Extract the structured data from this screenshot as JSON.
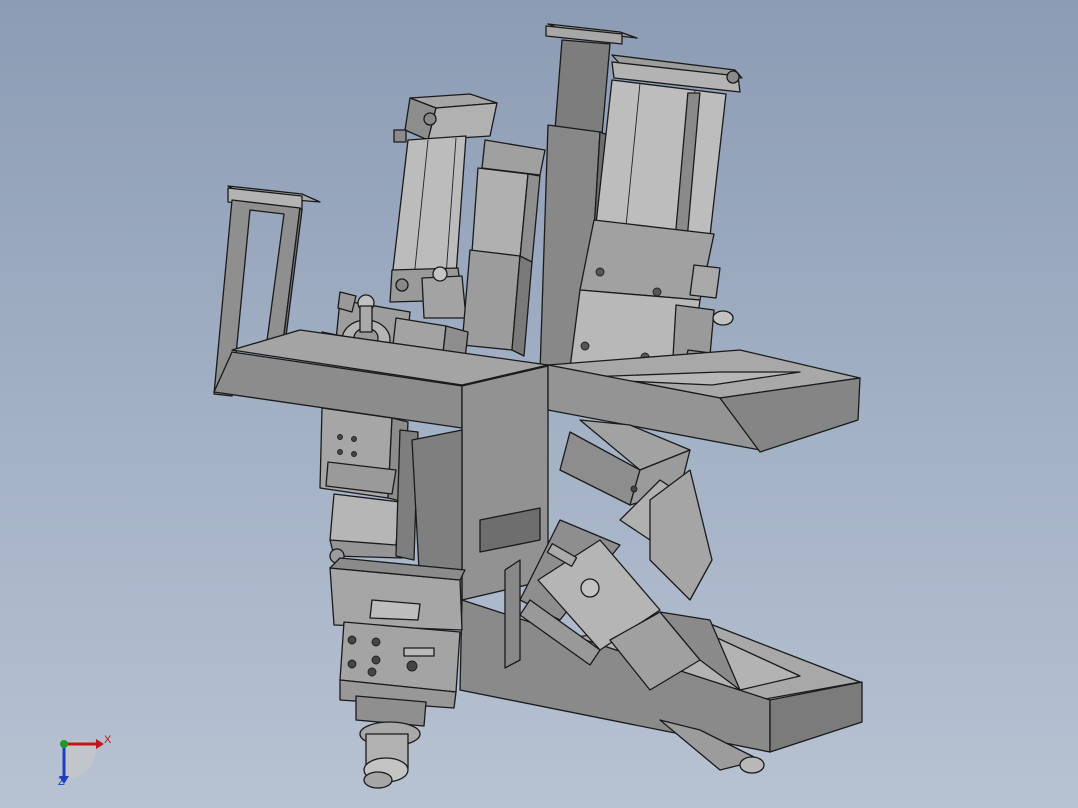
{
  "scene": {
    "background_top": "#8c9cb4",
    "background_bottom": "#b7c2d2",
    "part_color": "#8f8f8f",
    "part_light": "#a9a9a9",
    "part_dark": "#6e6e6e",
    "edge_color": "#1a1a1a"
  },
  "triad": {
    "x_label": "X",
    "z_label": "Z",
    "x_color": "#c0181a",
    "y_color": "#1f9a2a",
    "z_color": "#1e3fbf"
  }
}
